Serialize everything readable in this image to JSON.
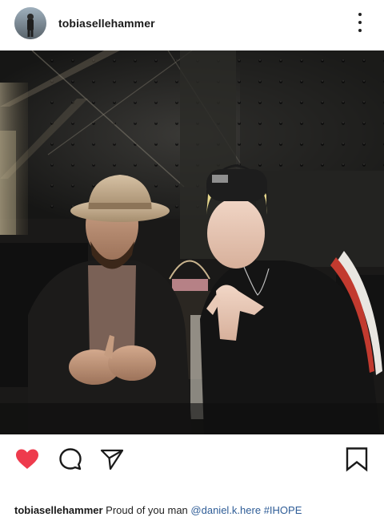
{
  "post": {
    "username": "tobiasellehammer",
    "caption": {
      "username": "tobiasellehammer",
      "text": "Proud of you man",
      "mention": "@daniel.k.here",
      "hashtag": "#IHOPE"
    }
  },
  "icons": {
    "more": "more-vertical-icon",
    "user_tag": "person-icon",
    "like": "heart-filled-icon",
    "comment": "speech-bubble-icon",
    "share": "paper-plane-icon",
    "save": "bookmark-icon"
  },
  "colors": {
    "like_active": "#ee3b4d",
    "link": "#2f5d97",
    "text": "#1a1a1a"
  }
}
